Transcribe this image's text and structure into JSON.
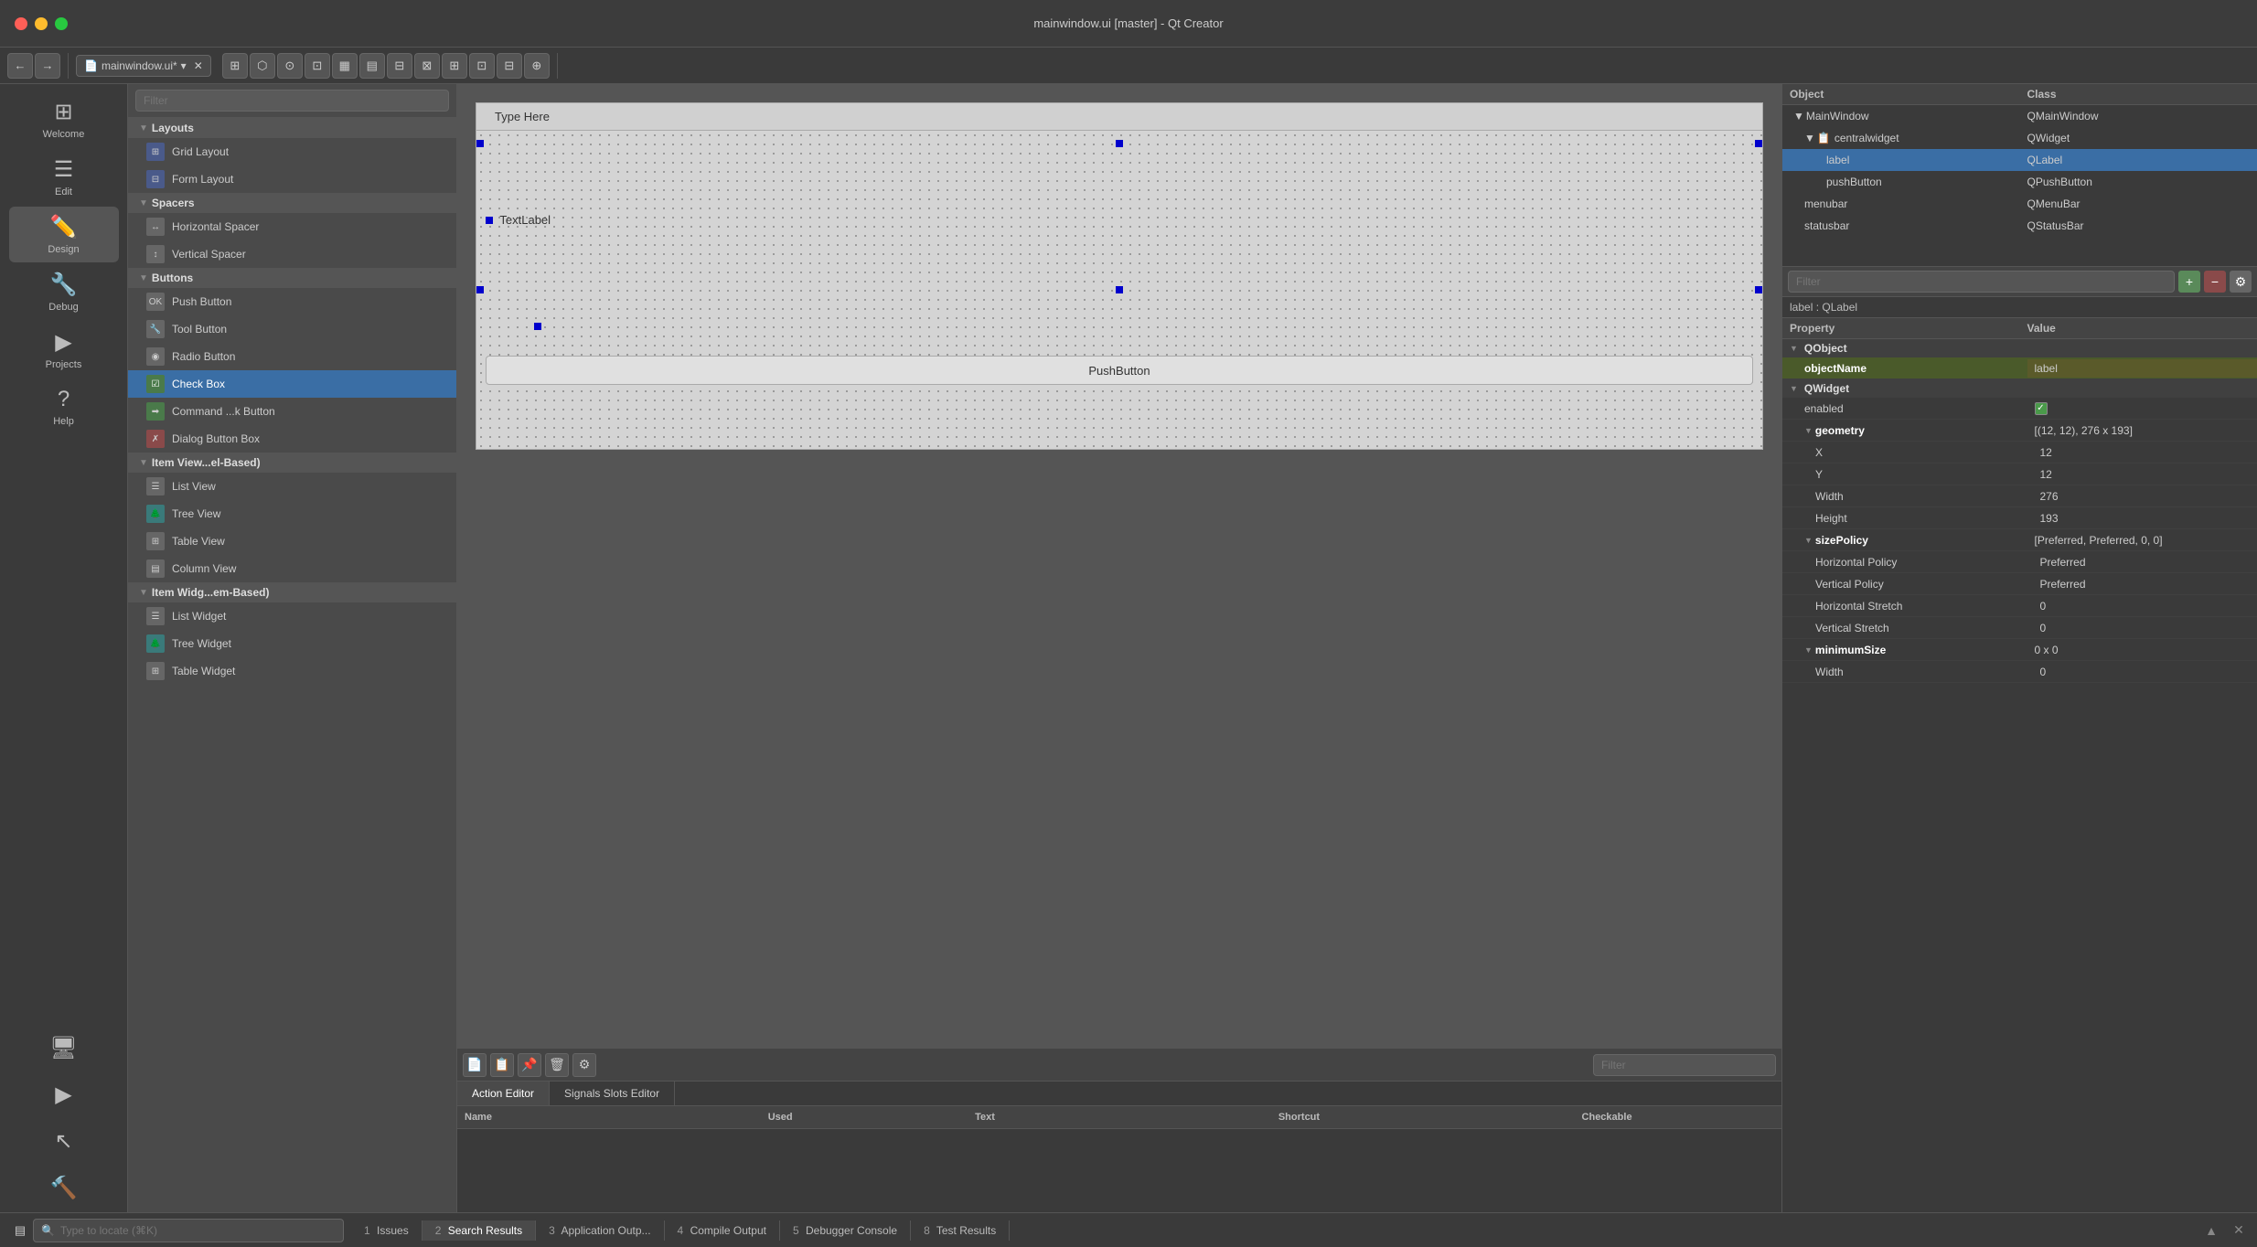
{
  "titleBar": {
    "title": "mainwindow.ui [master] - Qt Creator"
  },
  "toolbar": {
    "fileName": "mainwindow.ui*",
    "fileIcon": "📄",
    "buttons": [
      "←",
      "→",
      "⊞",
      "✕",
      "⊡",
      "⬜",
      "▦",
      "▦",
      "▦",
      "▦",
      "▦",
      "▦"
    ]
  },
  "sidebar": {
    "items": [
      {
        "id": "welcome",
        "label": "Welcome",
        "icon": "⊞"
      },
      {
        "id": "edit",
        "label": "Edit",
        "icon": "☰"
      },
      {
        "id": "design",
        "label": "Design",
        "icon": "✏"
      },
      {
        "id": "debug",
        "label": "Debug",
        "icon": "🔧"
      },
      {
        "id": "projects",
        "label": "Projects",
        "icon": "🗂"
      },
      {
        "id": "help",
        "label": "Help",
        "icon": "?"
      }
    ]
  },
  "widgetPanel": {
    "filterPlaceholder": "Filter",
    "categories": [
      {
        "id": "layouts",
        "label": "Layouts",
        "collapsed": false,
        "items": [
          {
            "id": "grid-layout",
            "label": "Grid Layout",
            "iconType": "blue"
          },
          {
            "id": "form-layout",
            "label": "Form Layout",
            "iconType": "blue"
          }
        ]
      },
      {
        "id": "spacers",
        "label": "Spacers",
        "collapsed": false,
        "items": [
          {
            "id": "horizontal-spacer",
            "label": "Horizontal Spacer",
            "iconType": "gray"
          },
          {
            "id": "vertical-spacer",
            "label": "Vertical Spacer",
            "iconType": "gray"
          }
        ]
      },
      {
        "id": "buttons",
        "label": "Buttons",
        "collapsed": false,
        "items": [
          {
            "id": "push-button",
            "label": "Push Button",
            "iconType": "gray"
          },
          {
            "id": "tool-button",
            "label": "Tool Button",
            "iconType": "gray"
          },
          {
            "id": "radio-button",
            "label": "Radio Button",
            "iconType": "gray"
          },
          {
            "id": "check-box",
            "label": "Check Box",
            "iconType": "green",
            "selected": true
          },
          {
            "id": "command-button",
            "label": "Command ...k Button",
            "iconType": "green"
          },
          {
            "id": "dialog-button-box",
            "label": "Dialog Button Box",
            "iconType": "red"
          }
        ]
      },
      {
        "id": "item-views",
        "label": "Item View...el-Based)",
        "collapsed": false,
        "items": [
          {
            "id": "list-view",
            "label": "List View",
            "iconType": "gray"
          },
          {
            "id": "tree-view",
            "label": "Tree View",
            "iconType": "teal"
          },
          {
            "id": "table-view",
            "label": "Table View",
            "iconType": "gray"
          },
          {
            "id": "column-view",
            "label": "Column View",
            "iconType": "gray"
          }
        ]
      },
      {
        "id": "item-widgets",
        "label": "Item Widg...em-Based)",
        "collapsed": false,
        "items": [
          {
            "id": "list-widget",
            "label": "List Widget",
            "iconType": "gray"
          },
          {
            "id": "tree-widget",
            "label": "Tree Widget",
            "iconType": "teal"
          },
          {
            "id": "table-widget",
            "label": "Table Widget",
            "iconType": "gray"
          }
        ]
      }
    ]
  },
  "canvas": {
    "menuItem": "Type Here",
    "textLabel": "TextLabel",
    "pushButton": "PushButton"
  },
  "actionEditor": {
    "filterPlaceholder": "Filter",
    "tabs": [
      {
        "id": "action-editor",
        "label": "Action Editor",
        "active": true
      },
      {
        "id": "signals-slots",
        "label": "Signals Slots Editor"
      }
    ],
    "columns": [
      "Name",
      "Used",
      "Text",
      "Shortcut",
      "Checkable"
    ]
  },
  "objectTree": {
    "header": {
      "col1": "Object",
      "col2": "Class"
    },
    "items": [
      {
        "id": "mainwindow",
        "indent": 0,
        "arrow": "▼",
        "icon": "🔷",
        "name": "MainWindow",
        "class": "QMainWindow"
      },
      {
        "id": "centralwidget",
        "indent": 1,
        "arrow": "▼",
        "icon": "📋",
        "name": "centralwidget",
        "class": "QWidget"
      },
      {
        "id": "label",
        "indent": 2,
        "arrow": "",
        "icon": "",
        "name": "label",
        "class": "QLabel",
        "selected": true
      },
      {
        "id": "pushbutton",
        "indent": 2,
        "arrow": "",
        "icon": "",
        "name": "pushButton",
        "class": "QPushButton"
      },
      {
        "id": "menubar",
        "indent": 1,
        "arrow": "",
        "icon": "",
        "name": "menubar",
        "class": "QMenuBar"
      },
      {
        "id": "statusbar",
        "indent": 1,
        "arrow": "",
        "icon": "",
        "name": "statusbar",
        "class": "QStatusBar"
      }
    ]
  },
  "propertiesPanel": {
    "filterPlaceholder": "Filter",
    "selectedLabel": "label : QLabel",
    "header": {
      "col1": "Property",
      "col2": "Value"
    },
    "sections": [
      {
        "id": "qobject",
        "label": "QObject",
        "properties": [
          {
            "name": "objectName",
            "value": "label",
            "bold": true,
            "highlight": true
          }
        ]
      },
      {
        "id": "qwidget",
        "label": "QWidget",
        "properties": [
          {
            "name": "enabled",
            "value": "checkbox",
            "type": "checkbox"
          },
          {
            "name": "geometry",
            "value": "[(12, 12), 276 x 193]",
            "bold": true,
            "expanded": true
          },
          {
            "name": "X",
            "value": "12",
            "indent": true
          },
          {
            "name": "Y",
            "value": "12",
            "indent": true
          },
          {
            "name": "Width",
            "value": "276",
            "indent": true
          },
          {
            "name": "Height",
            "value": "193",
            "indent": true
          },
          {
            "name": "sizePolicy",
            "value": "[Preferred, Preferred, 0, 0]",
            "bold": true,
            "expanded": true
          },
          {
            "name": "Horizontal Policy",
            "value": "Preferred",
            "indent": true
          },
          {
            "name": "Vertical Policy",
            "value": "Preferred",
            "indent": true
          },
          {
            "name": "Horizontal Stretch",
            "value": "0",
            "indent": true
          },
          {
            "name": "Vertical Stretch",
            "value": "0",
            "indent": true
          },
          {
            "name": "minimumSize",
            "value": "0 x 0",
            "bold": true,
            "expanded": true
          },
          {
            "name": "Width",
            "value": "0",
            "indent": true
          }
        ]
      }
    ]
  },
  "statusBar": {
    "locatePlaceholder": "Type to locate (⌘K)",
    "tabs": [
      {
        "num": "1",
        "label": "Issues"
      },
      {
        "num": "2",
        "label": "Search Results",
        "active": true
      },
      {
        "num": "3",
        "label": "Application Outp..."
      },
      {
        "num": "4",
        "label": "Compile Output"
      },
      {
        "num": "5",
        "label": "Debugger Console"
      },
      {
        "num": "8",
        "label": "Test Results"
      }
    ]
  }
}
